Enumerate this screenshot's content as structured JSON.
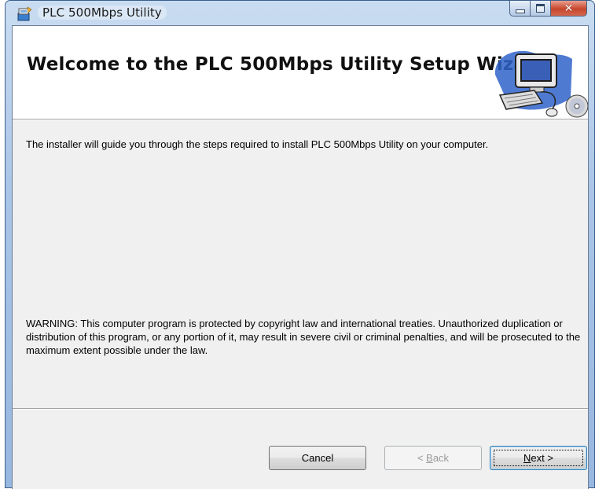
{
  "window": {
    "title": "PLC 500Mbps Utility",
    "close_glyph": "✕"
  },
  "header": {
    "title": "Welcome to the PLC 500Mbps Utility Setup Wizard"
  },
  "body": {
    "intro": "The installer will guide you through the steps required to install PLC 500Mbps Utility on your computer.",
    "warning": "WARNING: This computer program is protected by copyright law and international treaties. Unauthorized duplication or distribution of this program, or any portion of it, may result in severe civil or criminal penalties, and will be prosecuted to the maximum extent possible under the law."
  },
  "buttons": {
    "cancel": "Cancel",
    "back_prefix": "< ",
    "back_mnemonic": "B",
    "back_rest": "ack",
    "next_mnemonic": "N",
    "next_rest": "ext >"
  },
  "icons": {
    "app": "installer-icon",
    "header": "computer-setup-icon"
  },
  "colors": {
    "title_bar": "#a9c4e6",
    "close_button": "#c7462c",
    "dialog_background": "#f0f0f0"
  }
}
